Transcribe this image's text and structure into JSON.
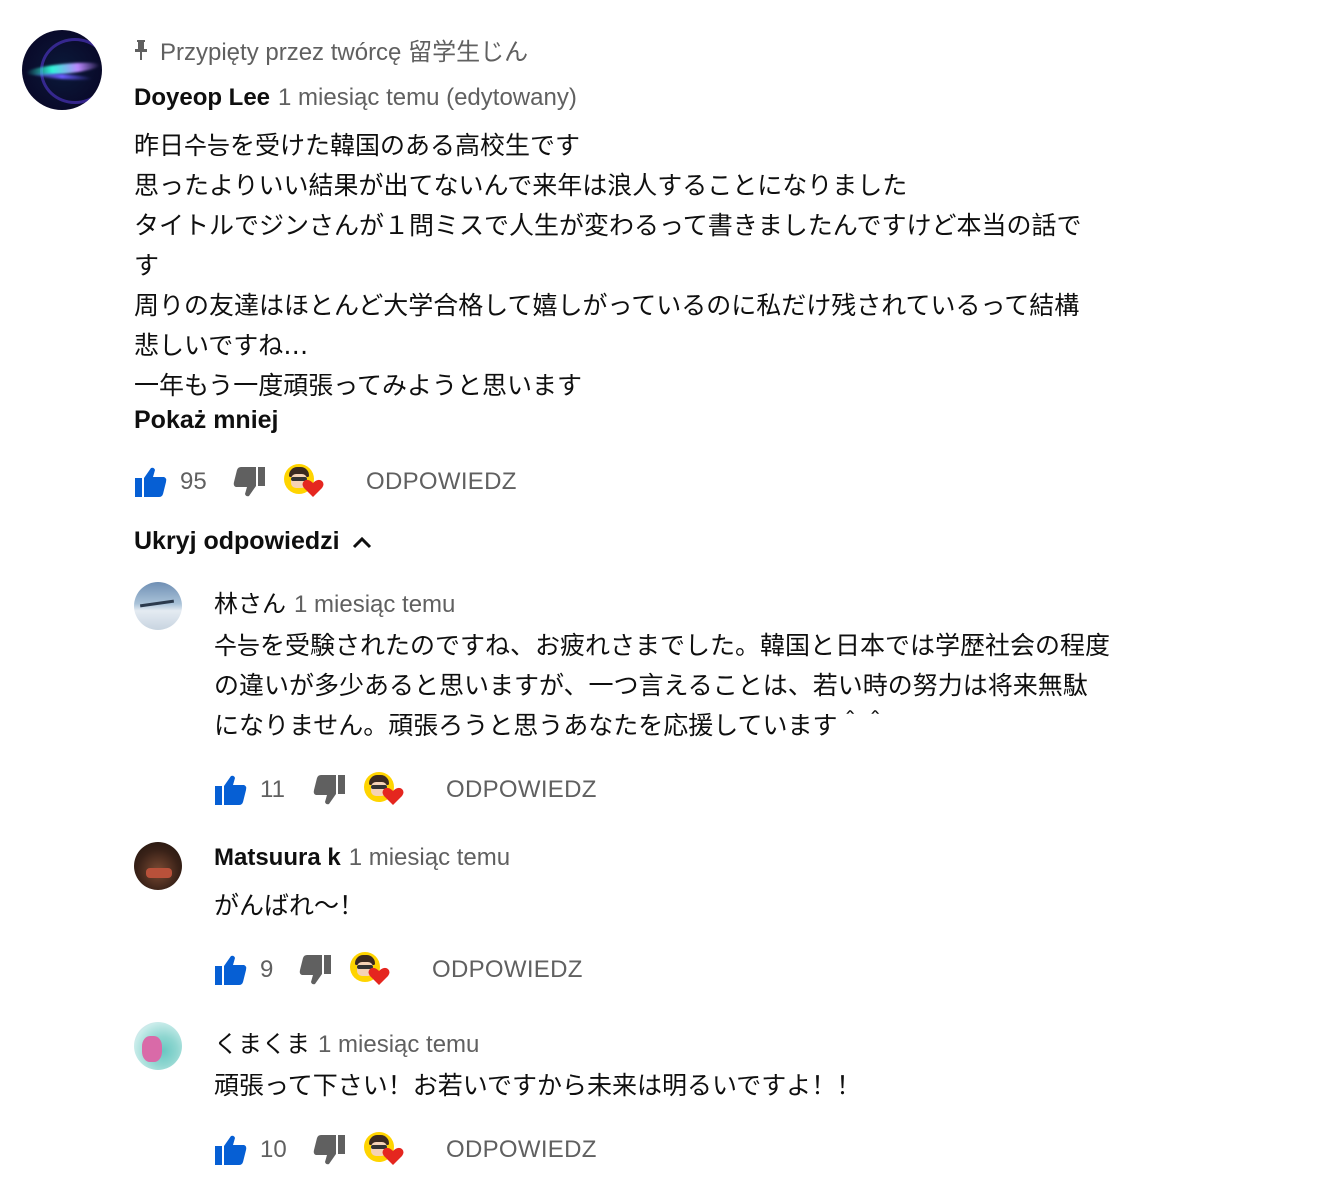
{
  "pinned": {
    "label": "Przypięty przez twórcę 留学生じん",
    "icon": "pin-icon"
  },
  "main_comment": {
    "author": "Doyeop Lee",
    "time": "1 miesiąc temu (edytowany)",
    "lines": [
      "昨日수능を受けた韓国のある高校生です",
      "思ったよりいい結果が出てないんで来年は浪人することになりました",
      "タイトルでジンさんが１問ミスで人生が変わるって書きましたんですけど本当の話で",
      "す",
      "周りの友達はほとんど大学合格して嬉しがっているのに私だけ残されているって結構",
      "悲しいですね…",
      "一年もう一度頑張ってみようと思います"
    ],
    "show_less": "Pokaż mniej",
    "likes": "95",
    "reply_label": "ODPOWIEDZ"
  },
  "toggle_replies": {
    "label": "Ukryj odpowiedzi",
    "icon": "chevron-up-icon"
  },
  "replies": [
    {
      "author": "林さん",
      "time": "1 miesiąc temu",
      "lines": [
        "수능を受験されたのですね、お疲れさまでした。韓国と日本では学歴社会の程度",
        "の違いが多少あると思いますが、一つ言えることは、若い時の努力は将来無駄",
        "になりません。頑張ろうと思うあなたを応援しています＾＾"
      ],
      "likes": "11",
      "reply_label": "ODPOWIEDZ"
    },
    {
      "author": "Matsuura k",
      "time": "1 miesiąc temu",
      "lines": [
        "がんばれ〜！"
      ],
      "likes": "9",
      "reply_label": "ODPOWIEDZ"
    },
    {
      "author": "くまくま",
      "time": "1 miesiąc temu",
      "lines": [
        "頑張って下さい！お若いですから未来は明るいですよ！！"
      ],
      "likes": "10",
      "reply_label": "ODPOWIEDZ"
    }
  ],
  "colors": {
    "like_blue": "#065fd4",
    "dislike_gray": "#606060",
    "heart_red": "#e5261f",
    "meta_gray": "#606060"
  }
}
